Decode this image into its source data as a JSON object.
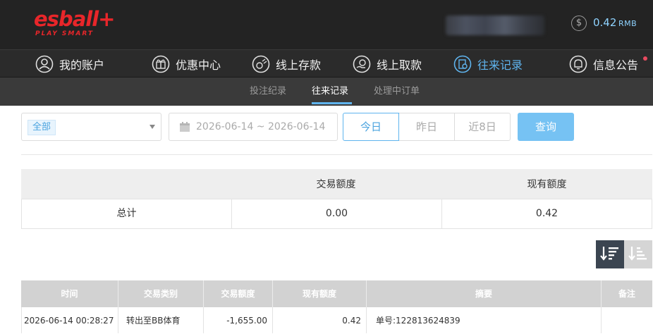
{
  "header": {
    "logo_main": "esball+",
    "logo_sub": "PLAY SMART",
    "balance_symbol": "$",
    "balance_amount": "0.42",
    "balance_unit": "RMB",
    "accent_color": "#5fb4ee",
    "logo_color": "#e8262a"
  },
  "nav": {
    "items": [
      {
        "label": "我的账户",
        "icon": "user-icon"
      },
      {
        "label": "优惠中心",
        "icon": "gift-icon"
      },
      {
        "label": "线上存款",
        "icon": "deposit-icon"
      },
      {
        "label": "线上取款",
        "icon": "withdraw-icon"
      },
      {
        "label": "往来记录",
        "icon": "records-icon",
        "active": true
      },
      {
        "label": "信息公告",
        "icon": "bell-icon"
      }
    ]
  },
  "subnav": {
    "items": [
      {
        "label": "投注纪录"
      },
      {
        "label": "往来记录",
        "active": true
      },
      {
        "label": "处理中订单"
      }
    ]
  },
  "filter": {
    "type_selected": "全部",
    "date_range": "2026-06-14 ~ 2026-06-14",
    "quick_today": "今日",
    "quick_yesterday": "昨日",
    "quick_week": "近8日",
    "query_label": "查询"
  },
  "summary": {
    "headers": [
      "",
      "交易额度",
      "现有额度"
    ],
    "row": [
      "总计",
      "0.00",
      "0.42"
    ]
  },
  "records": {
    "headers": [
      "时间",
      "交易类别",
      "交易额度",
      "现有额度",
      "摘要",
      "备注"
    ],
    "rows": [
      [
        "2026-06-14 00:28:27",
        "转出至BB体育",
        "-1,655.00",
        "0.42",
        "单号:122813624839",
        ""
      ]
    ]
  }
}
